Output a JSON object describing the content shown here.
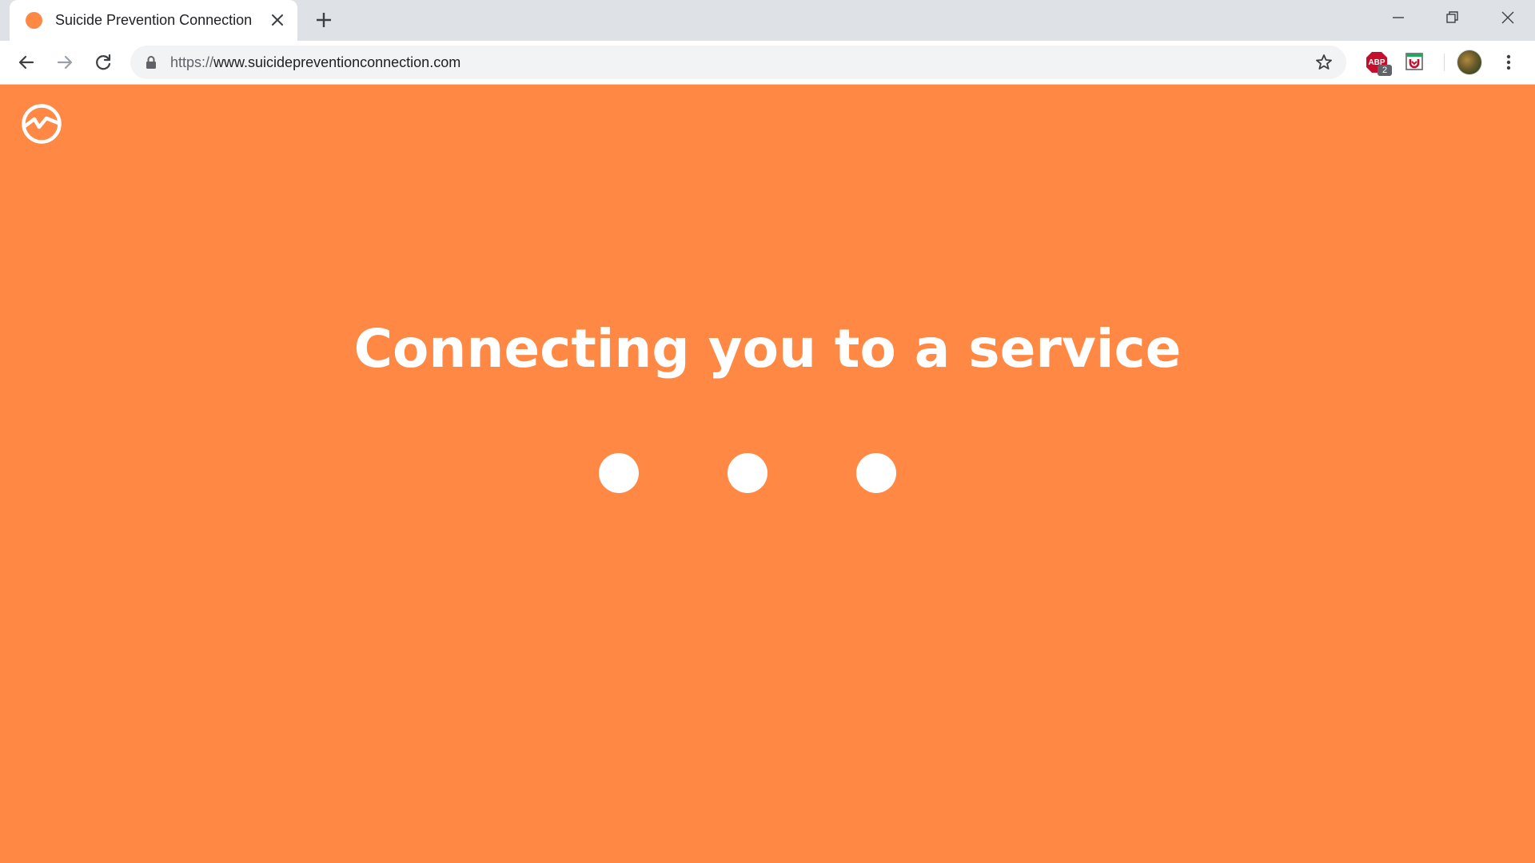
{
  "colors": {
    "page_background": "#ff8845",
    "favicon": "#ff8845",
    "tabstrip": "#dee1e6"
  },
  "tab": {
    "title": "Suicide Prevention Connection",
    "favicon_icon": "orange-circle-icon"
  },
  "toolbar": {
    "url_scheme": "https://",
    "url_host": "www.suicidepreventionconnection.com",
    "extensions": [
      {
        "name": "adblock-plus",
        "label": "ABP",
        "badge": "2"
      },
      {
        "name": "save-to-pocket",
        "label": ""
      }
    ]
  },
  "page": {
    "heading": "Connecting you to a service",
    "loading_dots": 3
  }
}
